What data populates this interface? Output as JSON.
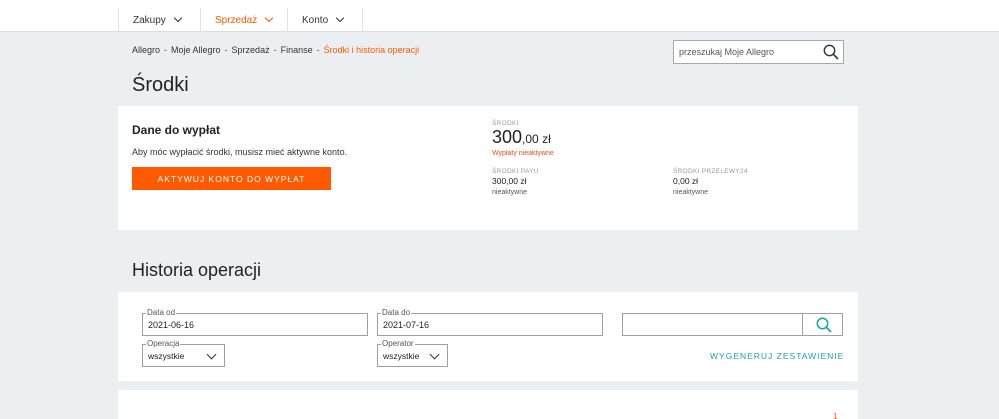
{
  "nav": {
    "items": [
      {
        "label": "Zakupy"
      },
      {
        "label": "Sprzedaż"
      },
      {
        "label": "Konto"
      }
    ]
  },
  "breadcrumb": {
    "items": [
      "Allegro",
      "Moje Allegro",
      "Sprzedaż",
      "Finanse"
    ],
    "current": "Środki i historia operacji",
    "separator": "-"
  },
  "search": {
    "placeholder": "przeszukaj Moje Allegro"
  },
  "page_title": "Środki",
  "payout": {
    "title": "Dane do wypłat",
    "description": "Aby móc wypłacić środki, musisz mieć aktywne konto.",
    "activate_button": "AKTYWUJ KONTO DO WYPŁAT"
  },
  "funds": {
    "main_label": "ŚRODKI",
    "main_amount_int": "300",
    "main_amount_frac": ",00 zł",
    "warning": "Wypłaty nieaktywne",
    "payu": {
      "label": "ŚRODKI PAYU",
      "amount": "300,00 zł",
      "status": "nieaktywne"
    },
    "przelewy24": {
      "label": "ŚRODKI PRZELEWY24",
      "amount": "0,00 zł",
      "status": "nieaktywne"
    }
  },
  "history": {
    "title": "Historia operacji",
    "date_from": {
      "label": "Data od",
      "value": "2021-06-16"
    },
    "date_to": {
      "label": "Data do",
      "value": "2021-07-16"
    },
    "operation": {
      "label": "Operacja",
      "value": "wszystkie"
    },
    "operator": {
      "label": "Operator",
      "value": "wszystkie"
    },
    "search_value": "",
    "generate_link": "WYGENERUJ ZESTAWIENIE"
  },
  "pagination": {
    "current": "1"
  },
  "colors": {
    "accent": "#ff5a00",
    "teal": "#1aa3a3",
    "background": "#eceff1"
  }
}
